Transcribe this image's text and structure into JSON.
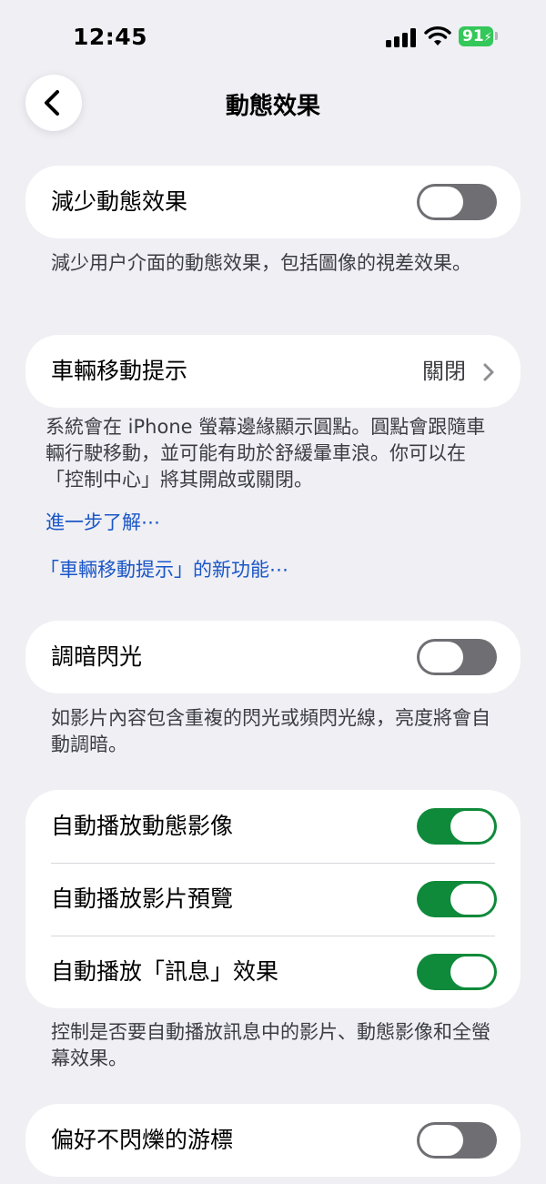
{
  "status": {
    "time": "12:45",
    "battery": "91"
  },
  "nav": {
    "title": "動態效果"
  },
  "reduce_motion": {
    "label": "減少動態效果",
    "on": false,
    "footer": "減少用户介面的動態效果，包括圖像的視差效果。"
  },
  "vehicle_cues": {
    "label": "車輛移動提示",
    "value": "關閉",
    "footer": "系統會在 iPhone 螢幕邊緣顯示圓點。圓點會跟隨車輛行駛移動，並可能有助於舒緩暈車浪。你可以在「控制中心」將其開啟或關閉。",
    "learn_more": "進一步了解⋯",
    "whats_new": "「車輛移動提示」的新功能⋯"
  },
  "dim_flashing": {
    "label": "調暗閃光",
    "on": false,
    "footer": "如影片內容包含重複的閃光或頻閃光線，亮度將會自動調暗。"
  },
  "autoplay": {
    "items": [
      {
        "label": "自動播放動態影像",
        "on": true
      },
      {
        "label": "自動播放影片預覽",
        "on": true
      },
      {
        "label": "自動播放「訊息」效果",
        "on": true
      }
    ],
    "footer": "控制是否要自動播放訊息中的影片、動態影像和全螢幕效果。"
  },
  "non_blinking_cursor": {
    "label": "偏好不閃爍的游標",
    "on": false
  }
}
